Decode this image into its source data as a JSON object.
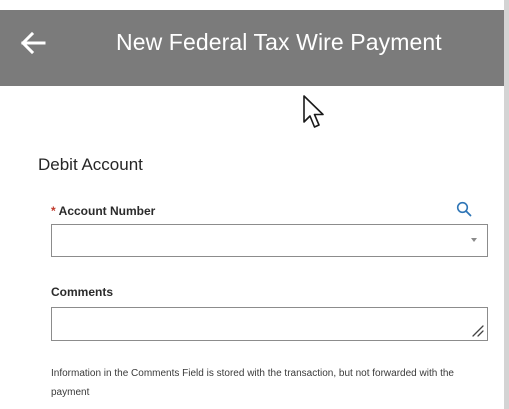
{
  "header": {
    "title": "New Federal Tax Wire Payment",
    "back_icon": "arrow-left-icon"
  },
  "section": {
    "title": "Debit Account"
  },
  "account_number": {
    "required_mark": "*",
    "label": "Account Number",
    "value": "",
    "lookup_icon": "search-icon",
    "dropdown_icon": "chevron-down-icon"
  },
  "comments": {
    "label": "Comments",
    "value": "",
    "info": "Information in the Comments Field is stored with the transaction, but not forwarded with the payment"
  },
  "colors": {
    "header_bg": "#7b7b7b",
    "header_text": "#ffffff",
    "required": "#c0392b",
    "accent_icon": "#2e75b6",
    "border": "#8c8c8c"
  }
}
